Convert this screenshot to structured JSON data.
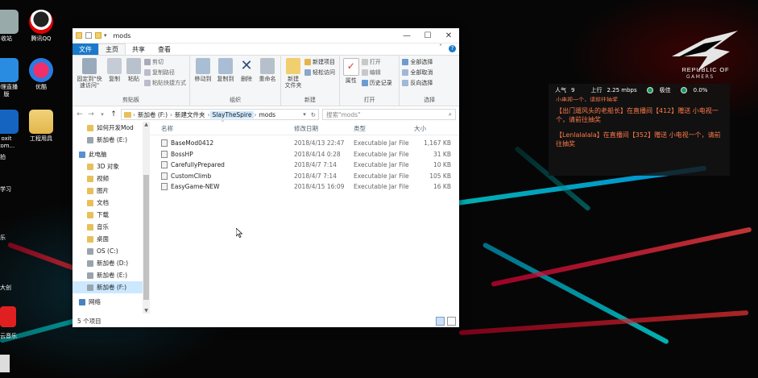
{
  "desktop": {
    "left_icons": [
      {
        "label": "收站"
      },
      {
        "label": "腾讯QQ"
      },
      {
        "label": "中理直播\n版"
      },
      {
        "label": "优酷"
      },
      {
        "label": "oxit\ntom..."
      },
      {
        "label": "工程用具"
      }
    ],
    "edge_labels": [
      "拍",
      "学习",
      "乐",
      "大创",
      "云音乐"
    ],
    "logo": {
      "line1": "REPUBLIC OF",
      "line2": "GAMERS"
    }
  },
  "stream_overlay": {
    "popularity_label": "人气",
    "popularity_value": "9",
    "upload_label": "上行",
    "upload_value": "2.25 mbps",
    "status_label": "极佳",
    "loss_value": "0.0%",
    "cut_message": "小电视一个，请前往抽奖",
    "messages": [
      "【出门遛风头的老船长】在直播间【412】赠送 小电视一个，请前往抽奖",
      "【Lenlalalala】在直播间【352】赠送 小电视一个，请前往抽奖"
    ]
  },
  "window": {
    "title": "mods",
    "controls": {
      "minimize": "—",
      "maximize": "☐",
      "close": "✕"
    },
    "tabs": [
      "文件",
      "主页",
      "共享",
      "查看"
    ],
    "ribbon": {
      "clipboard": {
        "label": "剪贴板",
        "pin": "固定到\"快速访问\"",
        "copy": "复制",
        "paste": "粘贴",
        "cut": "剪切",
        "copy_path": "复制路径",
        "paste_shortcut": "粘贴快捷方式"
      },
      "organize": {
        "label": "组织",
        "move_to": "移动到",
        "copy_to": "复制到",
        "delete": "删除",
        "rename": "重命名"
      },
      "new": {
        "label": "新建",
        "new_folder": "新建\n文件夹",
        "new_item": "新建项目",
        "easy_access": "轻松访问"
      },
      "open": {
        "label": "打开",
        "properties": "属性",
        "open": "打开",
        "edit": "编辑",
        "history": "历史记录"
      },
      "select": {
        "label": "选择",
        "select_all": "全部选择",
        "select_none": "全部取消",
        "invert": "反向选择"
      }
    },
    "address": {
      "crumbs": [
        "新加卷 (F:)",
        "新建文件夹",
        "SlayTheSpire",
        "mods"
      ],
      "search_placeholder": "搜索\"mods\""
    },
    "nav_items": [
      {
        "label": "如何开发Mod",
        "kind": "folder"
      },
      {
        "label": "新加卷 (E:)",
        "kind": "drive"
      },
      {
        "label": "此电脑",
        "kind": "pc"
      },
      {
        "label": "3D 对象",
        "kind": "folder"
      },
      {
        "label": "视频",
        "kind": "folder"
      },
      {
        "label": "图片",
        "kind": "folder"
      },
      {
        "label": "文档",
        "kind": "folder"
      },
      {
        "label": "下载",
        "kind": "folder"
      },
      {
        "label": "音乐",
        "kind": "folder"
      },
      {
        "label": "桌面",
        "kind": "folder"
      },
      {
        "label": "OS (C:)",
        "kind": "drive"
      },
      {
        "label": "新加卷 (D:)",
        "kind": "drive"
      },
      {
        "label": "新加卷 (E:)",
        "kind": "drive"
      },
      {
        "label": "新加卷 (F:)",
        "kind": "drive",
        "selected": true
      },
      {
        "label": "网络",
        "kind": "network"
      }
    ],
    "columns": {
      "name": "名称",
      "date": "修改日期",
      "type": "类型",
      "size": "大小"
    },
    "files": [
      {
        "name": "BaseMod0412",
        "date": "2018/4/13 22:47",
        "type": "Executable Jar File",
        "size": "1,167 KB"
      },
      {
        "name": "BossHP",
        "date": "2018/4/14 0:28",
        "type": "Executable Jar File",
        "size": "31 KB"
      },
      {
        "name": "CarefullyPrepared",
        "date": "2018/4/7 7:14",
        "type": "Executable Jar File",
        "size": "10 KB"
      },
      {
        "name": "CustomClimb",
        "date": "2018/4/7 7:14",
        "type": "Executable Jar File",
        "size": "105 KB"
      },
      {
        "name": "EasyGame-NEW",
        "date": "2018/4/15 16:09",
        "type": "Executable Jar File",
        "size": "16 KB"
      }
    ],
    "status": "5 个项目"
  }
}
